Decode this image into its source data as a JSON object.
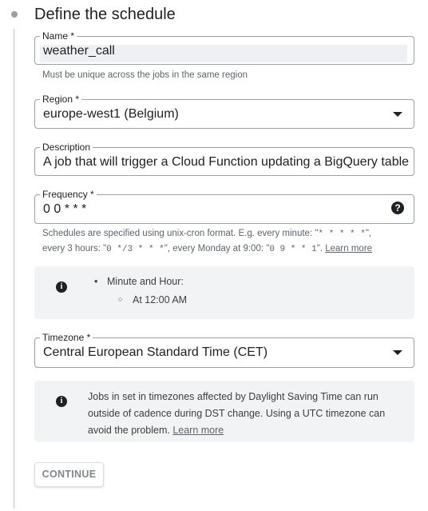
{
  "step": {
    "title": "Define the schedule"
  },
  "name": {
    "label": "Name *",
    "value": "weather_call",
    "hint": "Must be unique across the jobs in the same region"
  },
  "region": {
    "label": "Region *",
    "value": "europe-west1 (Belgium)"
  },
  "description": {
    "label": "Description",
    "value": "A job that will trigger a Cloud Function updating a BigQuery table"
  },
  "frequency": {
    "label": "Frequency *",
    "value": "0 0 * * *",
    "help_icon": "help-icon",
    "hint_line1_prefix": "Schedules are specified using unix-cron format. E.g. every minute: \"",
    "hint_line1_code": "* * * * *",
    "hint_line1_suffix": "\",",
    "hint_line2_prefix": "every 3 hours: \"",
    "hint_line2_code1": "0 */3 * * *",
    "hint_line2_mid": "\", every Monday at 9:00: \"",
    "hint_line2_code2": "0 9 * * 1",
    "hint_line2_suffix": "\".",
    "learn_more": "Learn more"
  },
  "frequency_info": {
    "icon": "info-icon",
    "bullet": "Minute and Hour:",
    "sub_bullet": "At 12:00 AM"
  },
  "timezone": {
    "label": "Timezone *",
    "value": "Central European Standard Time (CET)"
  },
  "dst_info": {
    "icon": "info-icon",
    "line1": "Jobs in set in timezones affected by Daylight Saving Time can run",
    "line2": "outside of cadence during DST change. Using a UTC timezone can",
    "line3": "avoid the problem.",
    "learn_more": "Learn more"
  },
  "continue_label": "CONTINUE"
}
